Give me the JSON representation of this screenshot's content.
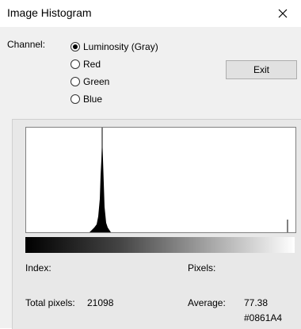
{
  "window": {
    "title": "Image Histogram",
    "close_glyph": "✕"
  },
  "channel": {
    "label": "Channel:",
    "options": [
      "Luminosity (Gray)",
      "Red",
      "Green",
      "Blue"
    ],
    "selected": "Luminosity (Gray)"
  },
  "buttons": {
    "exit_label": "Exit"
  },
  "histogram": {
    "peak_index": 77,
    "bar_color": "#000000"
  },
  "stats": {
    "index_label": "Index:",
    "pixels_label": "Pixels:",
    "total_pixels_label": "Total pixels:",
    "total_pixels_value": "21098",
    "average_label": "Average:",
    "average_value": "77.38",
    "average_hex": "#0861A4"
  }
}
